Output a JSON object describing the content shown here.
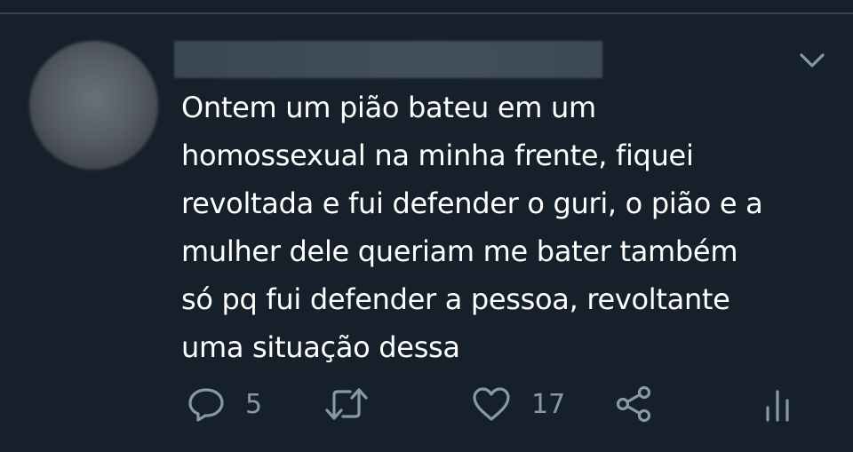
{
  "tweet": {
    "text": "Ontem um pião bateu em um\nhomossexual na minha frente, fiquei\nrevoltada e fui defender o guri, o pião e a\nmulher dele queriam me bater também\nsó pq fui defender a pessoa, revoltante\numa situação dessa"
  },
  "actions": {
    "reply_count": "5",
    "like_count": "17"
  },
  "icons": {
    "reply": "reply-icon",
    "retweet": "retweet-icon",
    "like": "heart-icon",
    "share": "share-icon",
    "analytics": "analytics-icon",
    "more": "chevron-down-icon"
  },
  "colors": {
    "background": "#15202b",
    "text": "#ffffff",
    "icon": "#8899a6",
    "divider": "#38444d"
  }
}
